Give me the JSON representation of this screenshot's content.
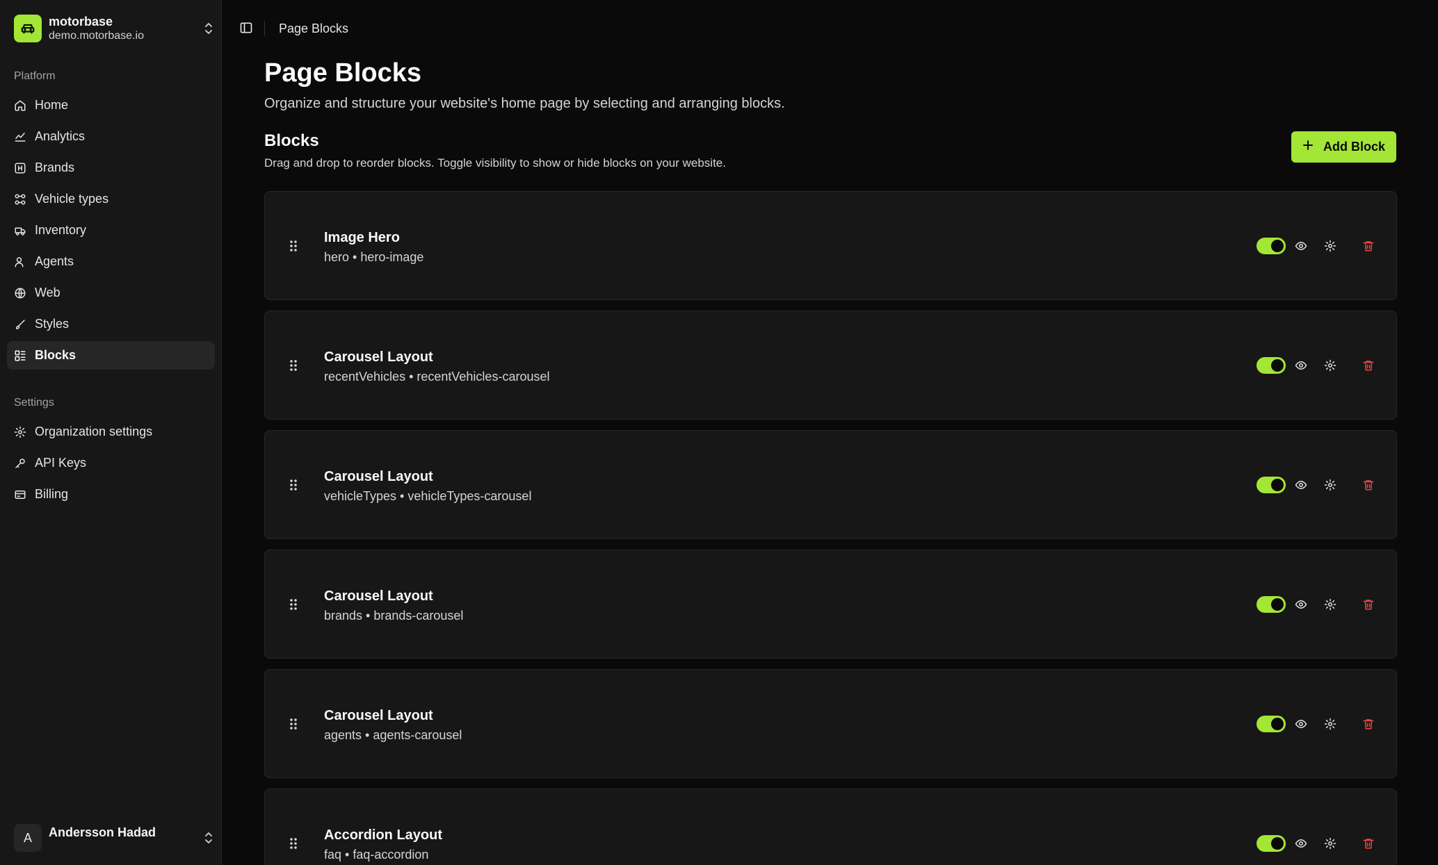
{
  "org": {
    "name": "motorbase",
    "domain": "demo.motorbase.io",
    "icon": "car-icon"
  },
  "sidebar": {
    "platform_label": "Platform",
    "platform_items": [
      {
        "label": "Home",
        "icon": "home-icon"
      },
      {
        "label": "Analytics",
        "icon": "chart-line-icon"
      },
      {
        "label": "Brands",
        "icon": "brand-badge-icon"
      },
      {
        "label": "Vehicle types",
        "icon": "vehicle-types-icon"
      },
      {
        "label": "Inventory",
        "icon": "truck-icon"
      },
      {
        "label": "Agents",
        "icon": "user-icon"
      },
      {
        "label": "Web",
        "icon": "globe-icon"
      },
      {
        "label": "Styles",
        "icon": "brush-icon"
      },
      {
        "label": "Blocks",
        "icon": "blocks-icon",
        "active": true
      }
    ],
    "settings_label": "Settings",
    "settings_items": [
      {
        "label": "Organization settings",
        "icon": "gear-icon"
      },
      {
        "label": "API Keys",
        "icon": "key-icon"
      },
      {
        "label": "Billing",
        "icon": "credit-card-icon"
      }
    ]
  },
  "user": {
    "name": "Andersson Hadad",
    "initial": "A"
  },
  "header": {
    "breadcrumb": "Page Blocks"
  },
  "page": {
    "title": "Page Blocks",
    "description": "Organize and structure your website's home page by selecting and arranging blocks."
  },
  "blocks_section": {
    "title": "Blocks",
    "description": "Drag and drop to reorder blocks. Toggle visibility to show or hide blocks on your website.",
    "add_label": "Add Block"
  },
  "blocks": [
    {
      "title": "Image Hero",
      "subtitle": "hero • hero-image",
      "enabled": true
    },
    {
      "title": "Carousel Layout",
      "subtitle": "recentVehicles • recentVehicles-carousel",
      "enabled": true
    },
    {
      "title": "Carousel Layout",
      "subtitle": "vehicleTypes • vehicleTypes-carousel",
      "enabled": true
    },
    {
      "title": "Carousel Layout",
      "subtitle": "brands • brands-carousel",
      "enabled": true
    },
    {
      "title": "Carousel Layout",
      "subtitle": "agents • agents-carousel",
      "enabled": true
    },
    {
      "title": "Accordion Layout",
      "subtitle": "faq • faq-accordion",
      "enabled": true
    }
  ],
  "colors": {
    "accent": "#a3e635",
    "danger": "#ef4444",
    "background": "#0a0a0a",
    "surface": "#171717"
  }
}
